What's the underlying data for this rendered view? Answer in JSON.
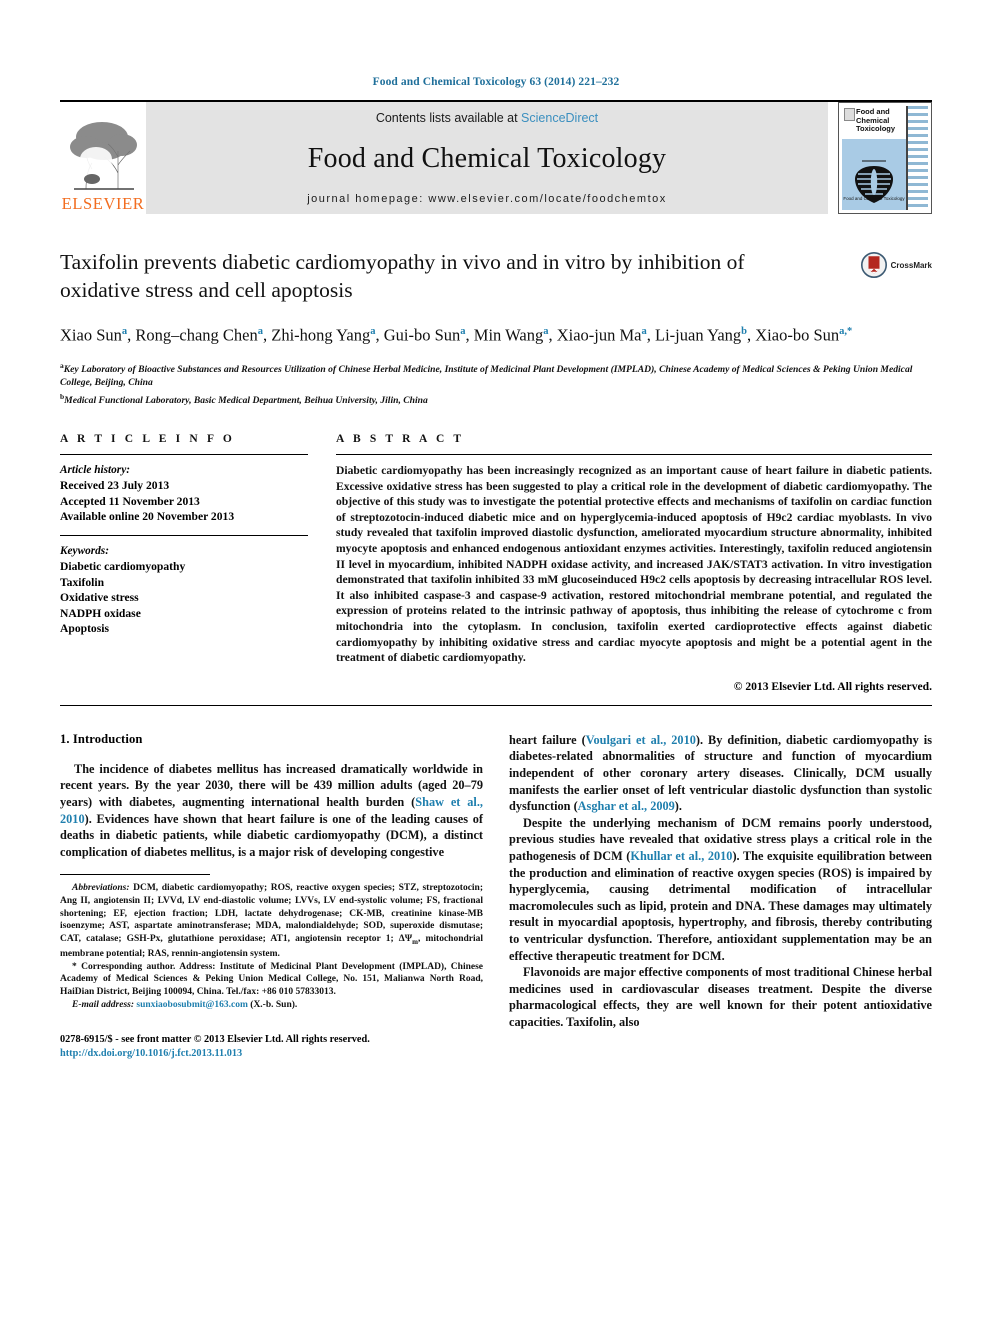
{
  "running_head": "Food and Chemical Toxicology 63 (2014) 221–232",
  "masthead": {
    "contents_prefix": "Contents lists available at ",
    "sciencedirect": "ScienceDirect",
    "journal_name": "Food and Chemical Toxicology",
    "homepage": "journal homepage: www.elsevier.com/locate/foodchemtox",
    "publisher": "ELSEVIER",
    "cover_title": "Food and Chemical Toxicology",
    "cover_caption": "Food and Chemical Toxicology"
  },
  "article": {
    "title": "Taxifolin prevents diabetic cardiomyopathy in vivo and in vitro by inhibition of oxidative stress and cell apoptosis",
    "crossmark_label": "CrossMark",
    "authors": [
      {
        "name": "Xiao Sun",
        "sup": "a"
      },
      {
        "name": "Rong–chang Chen",
        "sup": "a"
      },
      {
        "name": "Zhi-hong Yang",
        "sup": "a"
      },
      {
        "name": "Gui-bo Sun",
        "sup": "a"
      },
      {
        "name": "Min Wang",
        "sup": "a"
      },
      {
        "name": "Xiao-jun Ma",
        "sup": "a"
      },
      {
        "name": "Li-juan Yang",
        "sup": "b"
      },
      {
        "name": "Xiao-bo Sun",
        "sup": "a,*"
      }
    ],
    "affiliations": [
      {
        "mark": "a",
        "text": "Key Laboratory of Bioactive Substances and Resources Utilization of Chinese Herbal Medicine, Institute of Medicinal Plant Development (IMPLAD), Chinese Academy of Medical Sciences & Peking Union Medical College, Beijing, China"
      },
      {
        "mark": "b",
        "text": "Medical Functional Laboratory, Basic Medical Department, Beihua University, Jilin, China"
      }
    ]
  },
  "article_info": {
    "heading": "A R T I C L E    I N F O",
    "history_label": "Article history:",
    "history": [
      "Received 23 July 2013",
      "Accepted 11 November 2013",
      "Available online 20 November 2013"
    ],
    "keywords_label": "Keywords:",
    "keywords": [
      "Diabetic cardiomyopathy",
      "Taxifolin",
      "Oxidative stress",
      "NADPH oxidase",
      "Apoptosis"
    ]
  },
  "abstract": {
    "heading": "A B S T R A C T",
    "text": "Diabetic cardiomyopathy has been increasingly recognized as an important cause of heart failure in diabetic patients. Excessive oxidative stress has been suggested to play a critical role in the development of diabetic cardiomyopathy. The objective of this study was to investigate the potential protective effects and mechanisms of taxifolin on cardiac function of streptozotocin-induced diabetic mice and on hyperglycemia-induced apoptosis of H9c2 cardiac myoblasts. In vivo study revealed that taxifolin improved diastolic dysfunction, ameliorated myocardium structure abnormality, inhibited myocyte apoptosis and enhanced endogenous antioxidant enzymes activities. Interestingly, taxifolin reduced angiotensin II level in myocardium, inhibited NADPH oxidase activity, and increased JAK/STAT3 activation. In vitro investigation demonstrated that taxifolin inhibited 33 mM glucoseinduced H9c2 cells apoptosis by decreasing intracellular ROS level. It also inhibited caspase-3 and caspase-9 activation, restored mitochondrial membrane potential, and regulated the expression of proteins related to the intrinsic pathway of apoptosis, thus inhibiting the release of cytochrome c from mitochondria into the cytoplasm. In conclusion, taxifolin exerted cardioprotective effects against diabetic cardiomyopathy by inhibiting oxidative stress and cardiac myocyte apoptosis and might be a potential agent in the treatment of diabetic cardiomyopathy.",
    "copyright": "© 2013 Elsevier Ltd. All rights reserved."
  },
  "introduction": {
    "heading": "1. Introduction",
    "left_para_1_a": "The incidence of diabetes mellitus has increased dramatically worldwide in recent years. By the year 2030, there will be 439 million adults (aged 20–79 years) with diabetes, augmenting international health burden (",
    "left_para_1_ref": "Shaw et al., 2010",
    "left_para_1_b": "). Evidences have shown that heart failure is one of the leading causes of deaths in diabetic patients, while diabetic cardiomyopathy (DCM), a distinct complication of diabetes mellitus, is a major risk of developing congestive",
    "right_para_1_a": "heart failure (",
    "right_para_1_ref1": "Voulgari et al., 2010",
    "right_para_1_b": "). By definition, diabetic cardiomyopathy is diabetes-related abnormalities of structure and function of myocardium independent of other coronary artery diseases. Clinically, DCM usually manifests the earlier onset of left ventricular diastolic dysfunction than systolic dysfunction (",
    "right_para_1_ref2": "Asghar et al., 2009",
    "right_para_1_c": ").",
    "right_para_2_a": "Despite the underlying mechanism of DCM remains poorly understood, previous studies have revealed that oxidative stress plays a critical role in the pathogenesis of DCM (",
    "right_para_2_ref": "Khullar et al., 2010",
    "right_para_2_b": "). The exquisite equilibration between the production and elimination of reactive oxygen species (ROS) is impaired by hyperglycemia, causing detrimental modification of intracellular macromolecules such as lipid, protein and DNA. These damages may ultimately result in myocardial apoptosis, hypertrophy, and fibrosis, thereby contributing to ventricular dysfunction. Therefore, antioxidant supplementation may be an effective therapeutic treatment for DCM.",
    "right_para_3": "Flavonoids are major effective components of most traditional Chinese herbal medicines used in cardiovascular diseases treatment. Despite the diverse pharmacological effects, they are well known for their potent antioxidative capacities. Taxifolin, also"
  },
  "footnotes": {
    "abbrev_label": "Abbreviations:",
    "abbrev_text": " DCM, diabetic cardiomyopathy; ROS, reactive oxygen species; STZ, streptozotocin; Ang II, angiotensin II; LVVd, LV end-diastolic volume; LVVs, LV end-systolic volume; FS, fractional shortening; EF, ejection fraction; LDH, lactate dehydrogenase; CK-MB, creatinine kinase-MB isoenzyme; AST, aspartate aminotransferase; MDA, malondialdehyde; SOD, superoxide dismutase; CAT, catalase; GSH-Px, glutathione peroxidase; AT1, angiotensin receptor 1; ΔΨm, mitochondrial membrane potential; RAS, rennin-angiotensin system.",
    "corresponding_mark": "*",
    "corresponding_text": " Corresponding author. Address: Institute of Medicinal Plant Development (IMPLAD), Chinese Academy of Medical Sciences & Peking Union Medical College, No. 151, Malianwa North Road, HaiDian District, Beijing 100094, China. Tel./fax: +86 010 57833013.",
    "email_label": "E-mail address:",
    "email": "sunxiaobosubmit@163.com",
    "email_suffix": " (X.-b. Sun).",
    "issn_line": "0278-6915/$ - see front matter © 2013 Elsevier Ltd. All rights reserved.",
    "doi": "http://dx.doi.org/10.1016/j.fct.2013.11.013"
  }
}
